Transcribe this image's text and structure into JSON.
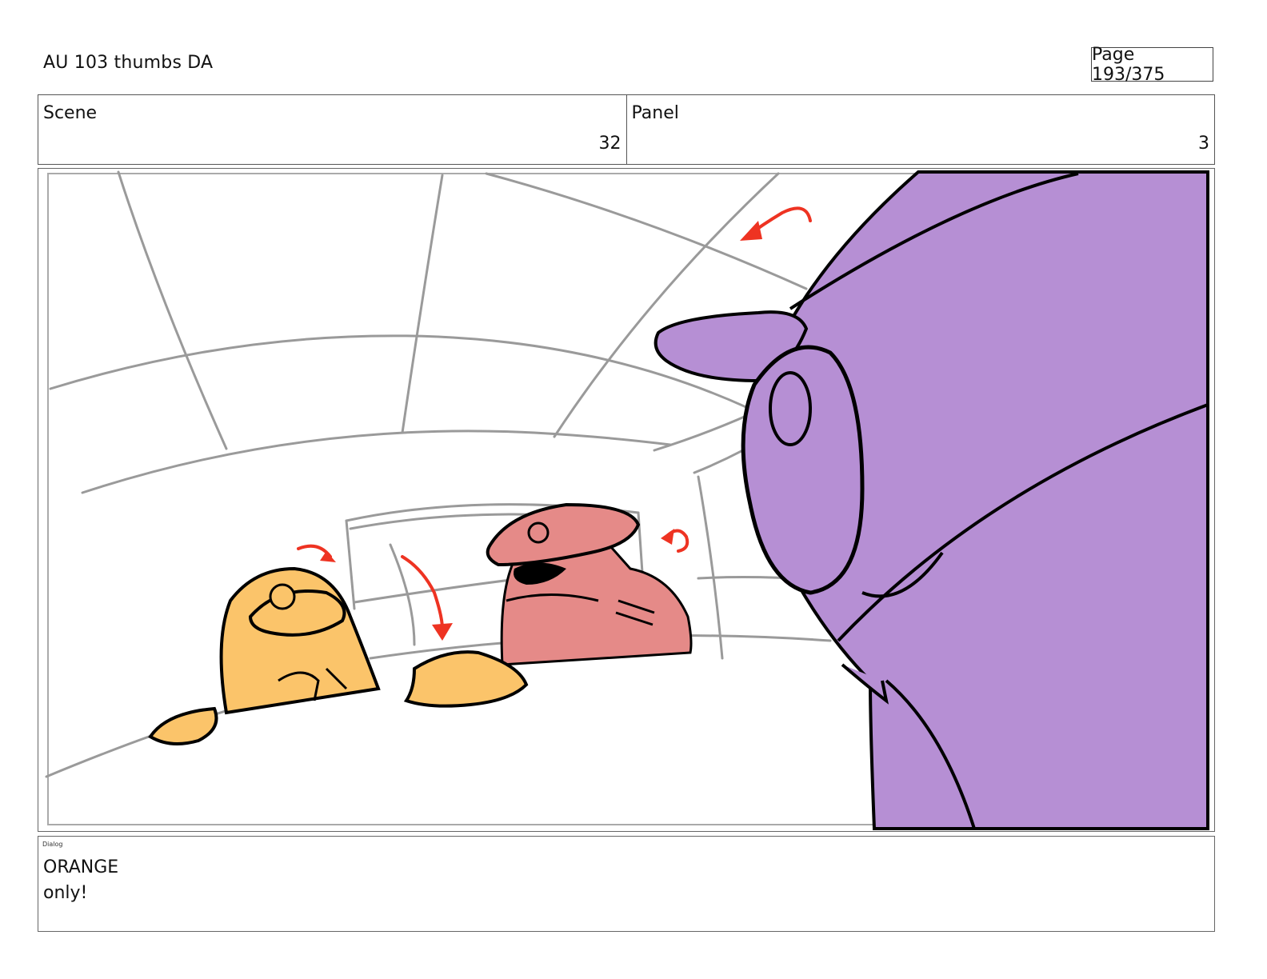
{
  "header": {
    "title": "AU 103 thumbs DA",
    "page_label": "Page 193/375"
  },
  "info": {
    "scene_label": "Scene",
    "scene_value": "32",
    "panel_label": "Panel",
    "panel_value": "3"
  },
  "artwork": {
    "description_colors": {
      "orange_character": "#fbc46a",
      "red_character": "#e58a88",
      "purple_character": "#b68fd4",
      "arrows": "#ee3322",
      "sketch_lines": "#999999"
    }
  },
  "dialog": {
    "label": "Dialog",
    "lines": [
      "ORANGE",
      "only!"
    ]
  }
}
